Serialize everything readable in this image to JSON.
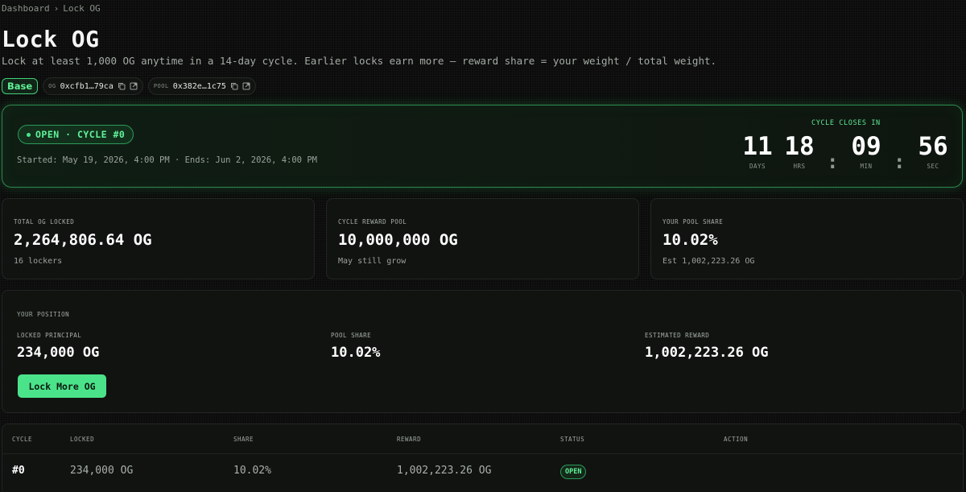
{
  "breadcrumb": {
    "parent": "Dashboard",
    "separator": "›",
    "current": "Lock OG"
  },
  "page": {
    "title": "Lock OG",
    "subtitle": "Lock at least 1,000 OG anytime in a 14-day cycle. Earlier locks earn more — reward share = your weight / total weight."
  },
  "chips": {
    "network": "Base",
    "og": {
      "label": "OG",
      "address": "0xcfb1…79ca"
    },
    "pool": {
      "label": "POOL",
      "address": "0x382e…1c75"
    }
  },
  "cycle": {
    "status": "OPEN · CYCLE #0",
    "dates": "Started: May 19, 2026, 4:00 PM · Ends: Jun 2, 2026, 4:00 PM",
    "countdown_label": "CYCLE CLOSES IN",
    "countdown": {
      "days": "11",
      "days_label": "DAYS",
      "hrs": "18",
      "hrs_label": "HRS",
      "min": "09",
      "min_label": "MIN",
      "sec": "56",
      "sec_label": "SEC",
      "separator": ":"
    }
  },
  "stats": [
    {
      "label": "TOTAL OG LOCKED",
      "value": "2,264,806.64 OG",
      "sub": "16 lockers"
    },
    {
      "label": "CYCLE REWARD POOL",
      "value": "10,000,000 OG",
      "sub": "May still grow"
    },
    {
      "label": "YOUR POOL SHARE",
      "value": "10.02%",
      "sub": "Est 1,002,223.26 OG"
    }
  ],
  "position": {
    "title": "YOUR POSITION",
    "locked_label": "LOCKED PRINCIPAL",
    "locked_value": "234,000 OG",
    "share_label": "POOL SHARE",
    "share_value": "10.02%",
    "reward_label": "ESTIMATED REWARD",
    "reward_value": "1,002,223.26 OG",
    "button": "Lock More OG"
  },
  "table": {
    "headers": [
      "CYCLE",
      "LOCKED",
      "SHARE",
      "REWARD",
      "STATUS",
      "ACTION"
    ],
    "rows": [
      {
        "cycle": "#0",
        "locked": "234,000 OG",
        "share": "10.02%",
        "reward": "1,002,223.26 OG",
        "status": "OPEN",
        "action": ""
      }
    ]
  },
  "colors": {
    "accent": "#4be38a",
    "background": "#0a0b0a",
    "card": "#111311"
  },
  "icons": [
    "copy-icon",
    "external-link-icon"
  ]
}
